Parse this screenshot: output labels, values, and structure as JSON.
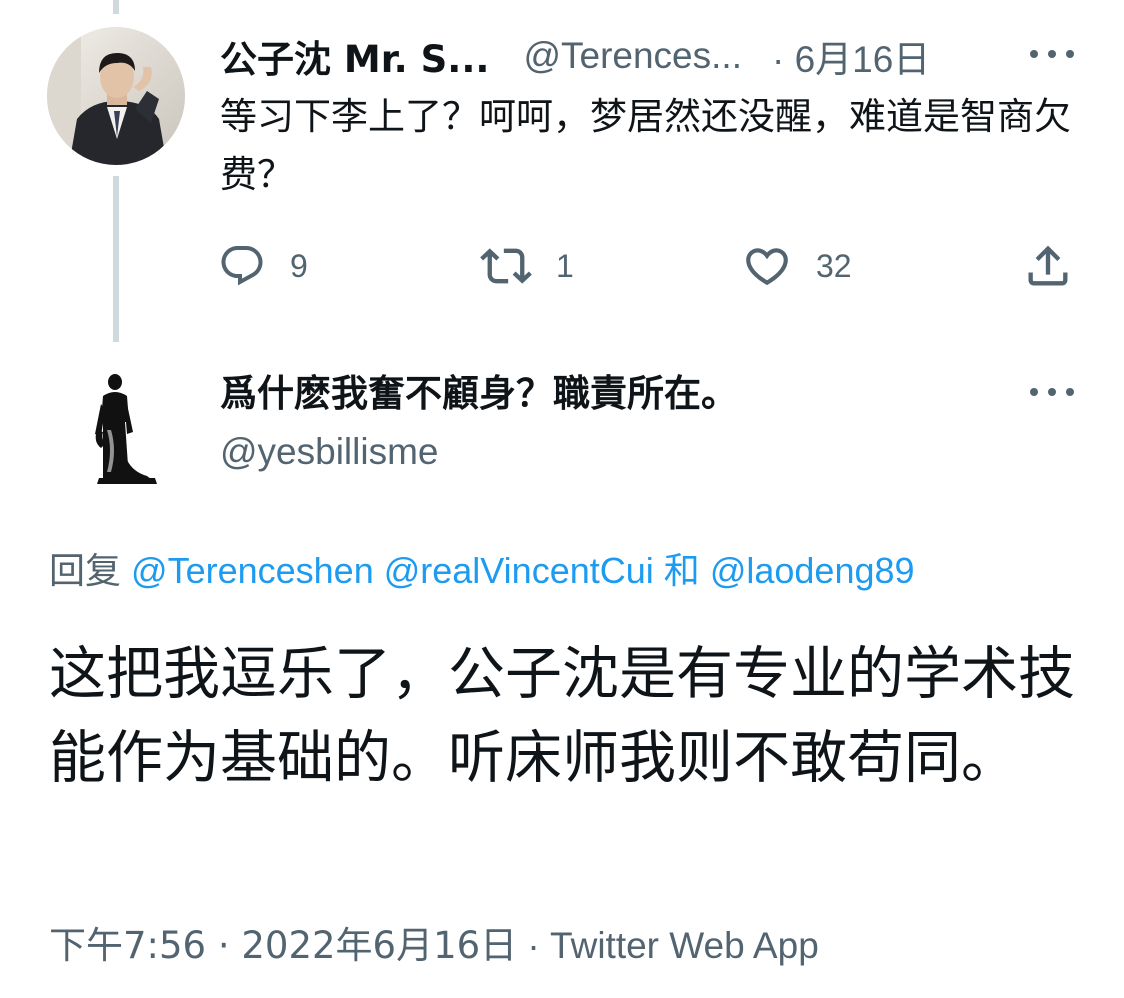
{
  "parent_tweet": {
    "author_name": "公子沈 Mr. S...",
    "handle": "@Terences...",
    "date": "· 6月16日",
    "text": "等习下李上了？呵呵，梦居然还没醒，难道是智商欠费？",
    "replies": "9",
    "retweets": "1",
    "likes": "32"
  },
  "main_tweet": {
    "author_name": "爲什麽我奮不顧身？職責所在。",
    "handle": "@yesbillisme",
    "reply_label": "回复",
    "mention_1": "@Terenceshen",
    "mention_2": "@realVincentCui",
    "reply_and": "和",
    "mention_3": "@laodeng89",
    "text": "这把我逗乐了，公子沈是有专业的学术技能作为基础的。听床师我则不敢苟同。",
    "timestamp": "下午7:56 · 2022年6月16日",
    "separator": " · ",
    "source": "Twitter Web App"
  },
  "colors": {
    "text": "#0f1419",
    "secondary": "#536471",
    "link": "#1d9bf0",
    "thread_line": "#cfd9de"
  },
  "icons": [
    "reply-icon",
    "retweet-icon",
    "like-icon",
    "share-icon",
    "more-icon"
  ]
}
